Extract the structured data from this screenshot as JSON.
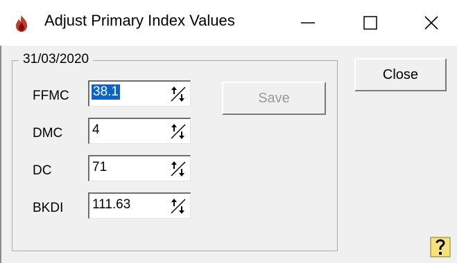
{
  "window": {
    "title": "Adjust Primary Index Values",
    "icon": "flame-icon",
    "controls": {
      "minimize": "minimize-icon",
      "maximize": "maximize-icon",
      "close": "close-icon"
    }
  },
  "group": {
    "legend": "31/03/2020"
  },
  "fields": [
    {
      "label": "FFMC",
      "value": "38.1",
      "selected": true
    },
    {
      "label": "DMC",
      "value": "4"
    },
    {
      "label": "DC",
      "value": "71"
    },
    {
      "label": "BKDI",
      "value": "111.63"
    }
  ],
  "buttons": {
    "save": "Save",
    "close": "Close"
  },
  "help": {
    "icon": "help-question-icon"
  },
  "colors": {
    "selection": "#0a64c8",
    "disabled_text": "#9a9a9a",
    "flame": "#c0392b"
  }
}
